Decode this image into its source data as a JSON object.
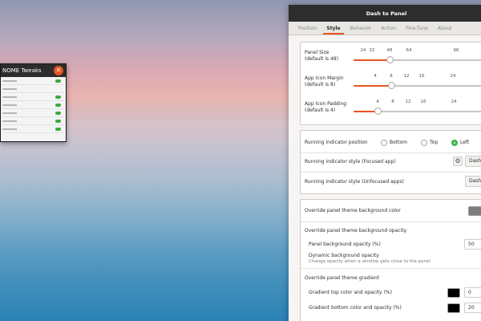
{
  "tweaks": {
    "title": "NOME Tweaks"
  },
  "window": {
    "title": "Dash to Panel",
    "tabs": [
      "Position",
      "Style",
      "Behavior",
      "Action",
      "Fine-Tune",
      "About"
    ],
    "active_tab": "Style"
  },
  "sizes": {
    "panel_size": {
      "label": "Panel Size",
      "default": "(default is 48)",
      "ticks": [
        "24",
        "32",
        "48",
        "64",
        "96"
      ],
      "value": 48
    },
    "icon_margin": {
      "label": "App Icon Margin",
      "default": "(default is 8)",
      "ticks": [
        "4",
        "8",
        "12",
        "16",
        "24"
      ],
      "value": 8
    },
    "icon_padding": {
      "label": "App Icon Padding",
      "default": "(default is 4)",
      "ticks": [
        "4",
        "8",
        "12",
        "16",
        "24"
      ],
      "value": 4
    }
  },
  "indicator": {
    "position_label": "Running indicator position",
    "options": [
      "Bottom",
      "Top",
      "Left"
    ],
    "selected": "Left",
    "focused_label": "Running indicator style (Focused app)",
    "focused_value": "Dashe",
    "unfocused_label": "Running indicator style (Unfocused apps)",
    "unfocused_value": "Dashe"
  },
  "theme": {
    "override_bg_color_label": "Override panel theme background color",
    "override_bg_opacity_label": "Override panel theme background opacity",
    "panel_bg_opacity_label": "Panel background opacity (%)",
    "panel_bg_opacity_value": "50",
    "dynamic_bg_opacity_label": "Dynamic background opacity",
    "dynamic_bg_opacity_desc": "Change opacity when a window gets close to the panel",
    "override_gradient_label": "Override panel theme gradient",
    "gradient_top_label": "Gradient top color and opacity (%)",
    "gradient_top_value": "0",
    "gradient_bottom_label": "Gradient bottom color and opacity (%)",
    "gradient_bottom_value": "20"
  },
  "colors": {
    "accent": "#e95420",
    "radio_checked": "#3eb34f",
    "bg_swatch": "#7d7d7d",
    "gradient_swatch": "#000000"
  }
}
